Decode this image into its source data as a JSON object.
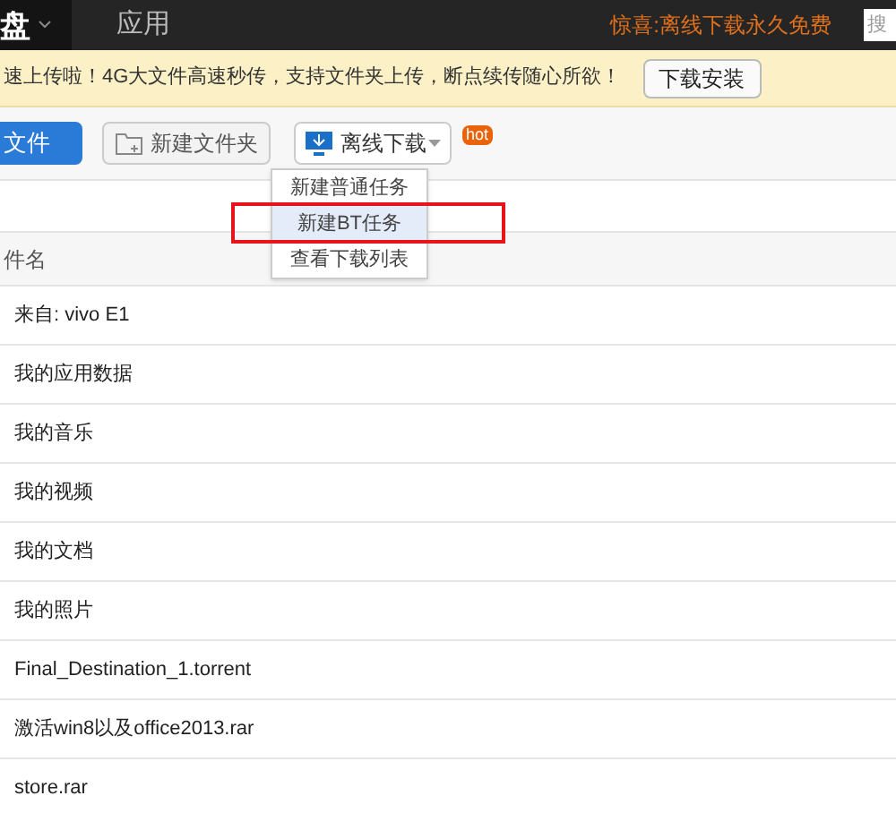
{
  "top_bar": {
    "logo_fragment": "盘",
    "nav": [
      {
        "label": "应用",
        "selected": false
      }
    ],
    "promo": "惊喜:离线下载永久免费",
    "search": {
      "placeholder": "搜"
    }
  },
  "banner": {
    "text": "速上传啦！4G大文件高速秒传，支持文件夹上传，断点续传随心所欲！",
    "button": "下载安装"
  },
  "toolbar": {
    "upload": "文件",
    "new_folder": "新建文件夹",
    "offline": "离线下载",
    "badge": "hot"
  },
  "dropdown": {
    "items": [
      {
        "label": "新建普通任务",
        "selected": false
      },
      {
        "label": "新建BT任务",
        "selected": true
      },
      {
        "label": "查看下载列表",
        "selected": false
      }
    ]
  },
  "table": {
    "header": "件名",
    "rows": [
      {
        "name": "来自: vivo E1"
      },
      {
        "name": "我的应用数据"
      },
      {
        "name": "我的音乐"
      },
      {
        "name": "我的视频"
      },
      {
        "name": "我的文档"
      },
      {
        "name": "我的照片"
      },
      {
        "name": "Final_Destination_1.torrent"
      },
      {
        "name": "激活win8以及office2013.rar"
      },
      {
        "name": "store.rar"
      }
    ]
  }
}
